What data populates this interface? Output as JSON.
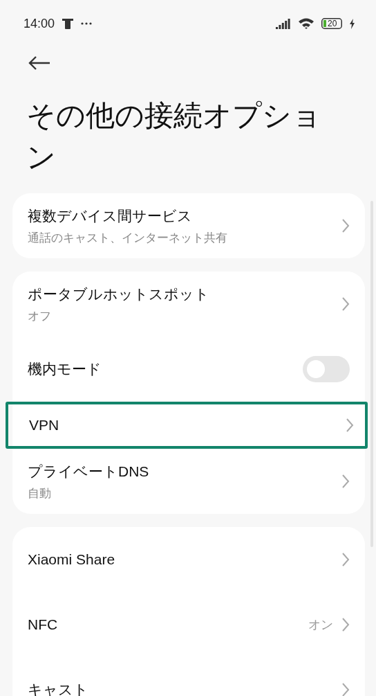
{
  "status_bar": {
    "time": "14:00",
    "battery": "20",
    "charging": true
  },
  "title": "その他の接続オプション",
  "groups": [
    {
      "items": [
        {
          "kind": "link",
          "label": "複数デバイス間サービス",
          "subtitle": "通話のキャスト、インターネット共有",
          "highlighted": false
        }
      ]
    },
    {
      "items": [
        {
          "kind": "link",
          "label": "ポータブルホットスポット",
          "subtitle": "オフ",
          "highlighted": false
        },
        {
          "kind": "toggle",
          "label": "機内モード",
          "on": false,
          "highlighted": false
        },
        {
          "kind": "link",
          "label": "VPN",
          "highlighted": true
        },
        {
          "kind": "link",
          "label": "プライベートDNS",
          "subtitle": "自動",
          "highlighted": false
        }
      ]
    },
    {
      "items": [
        {
          "kind": "link",
          "label": "Xiaomi Share",
          "highlighted": false
        },
        {
          "kind": "link",
          "label": "NFC",
          "value": "オン",
          "highlighted": false
        },
        {
          "kind": "link",
          "label": "キャスト",
          "highlighted": false
        }
      ]
    }
  ]
}
